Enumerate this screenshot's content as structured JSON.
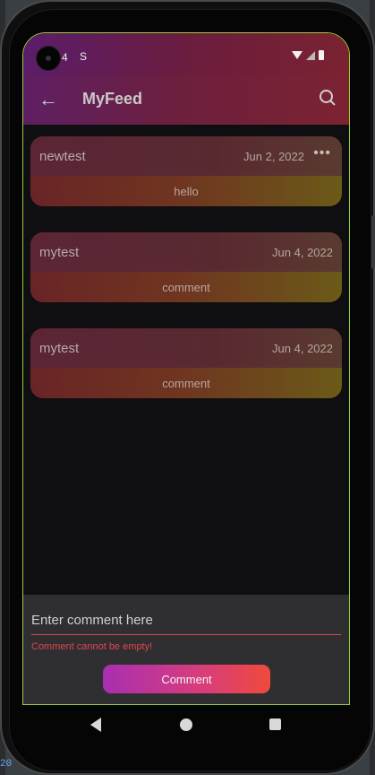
{
  "status_bar": {
    "number": "4",
    "icon_s": "S",
    "icons": [
      "wifi-icon",
      "signal-icon",
      "battery-icon"
    ]
  },
  "app_bar": {
    "title": "MyFeed",
    "back_icon": "arrow-left-icon",
    "search_icon": "search-icon"
  },
  "feed": [
    {
      "user": "newtest",
      "date": "Jun 2, 2022",
      "body": "hello",
      "has_menu": true
    },
    {
      "user": "mytest",
      "date": "Jun 4, 2022",
      "body": "comment",
      "has_menu": false
    },
    {
      "user": "mytest",
      "date": "Jun 4, 2022",
      "body": "comment",
      "has_menu": false
    }
  ],
  "card_menu_glyph": "•••",
  "composer": {
    "placeholder": "Enter comment here",
    "error": "Comment cannot be empty!",
    "button_label": "Comment"
  },
  "edge": {
    "number": "20"
  },
  "colors": {
    "accent_start": "#a82fb0",
    "accent_end": "#ef4a3c",
    "error": "#e2444e",
    "field_border": "#9ccc3a"
  }
}
